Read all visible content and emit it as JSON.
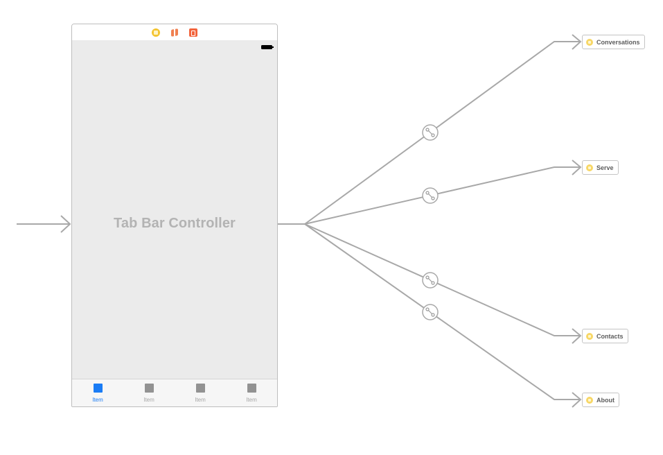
{
  "scene": {
    "title": "Tab Bar Controller",
    "dock_icons": [
      "view-controller-icon",
      "first-responder-icon",
      "exit-icon"
    ],
    "status_bar": {
      "battery": "battery-icon"
    },
    "tab_bar": {
      "items": [
        {
          "label": "Item",
          "selected": true
        },
        {
          "label": "Item",
          "selected": false
        },
        {
          "label": "Item",
          "selected": false
        },
        {
          "label": "Item",
          "selected": false
        }
      ]
    }
  },
  "destinations": [
    {
      "label": "Conversations"
    },
    {
      "label": "Serve"
    },
    {
      "label": "Contacts"
    },
    {
      "label": "About"
    }
  ],
  "colors": {
    "accent": "#1a7cf5",
    "segue_line": "#a8a8a8",
    "scene_background": "#ebebeb",
    "placeholder_text": "#b3b3b3"
  }
}
